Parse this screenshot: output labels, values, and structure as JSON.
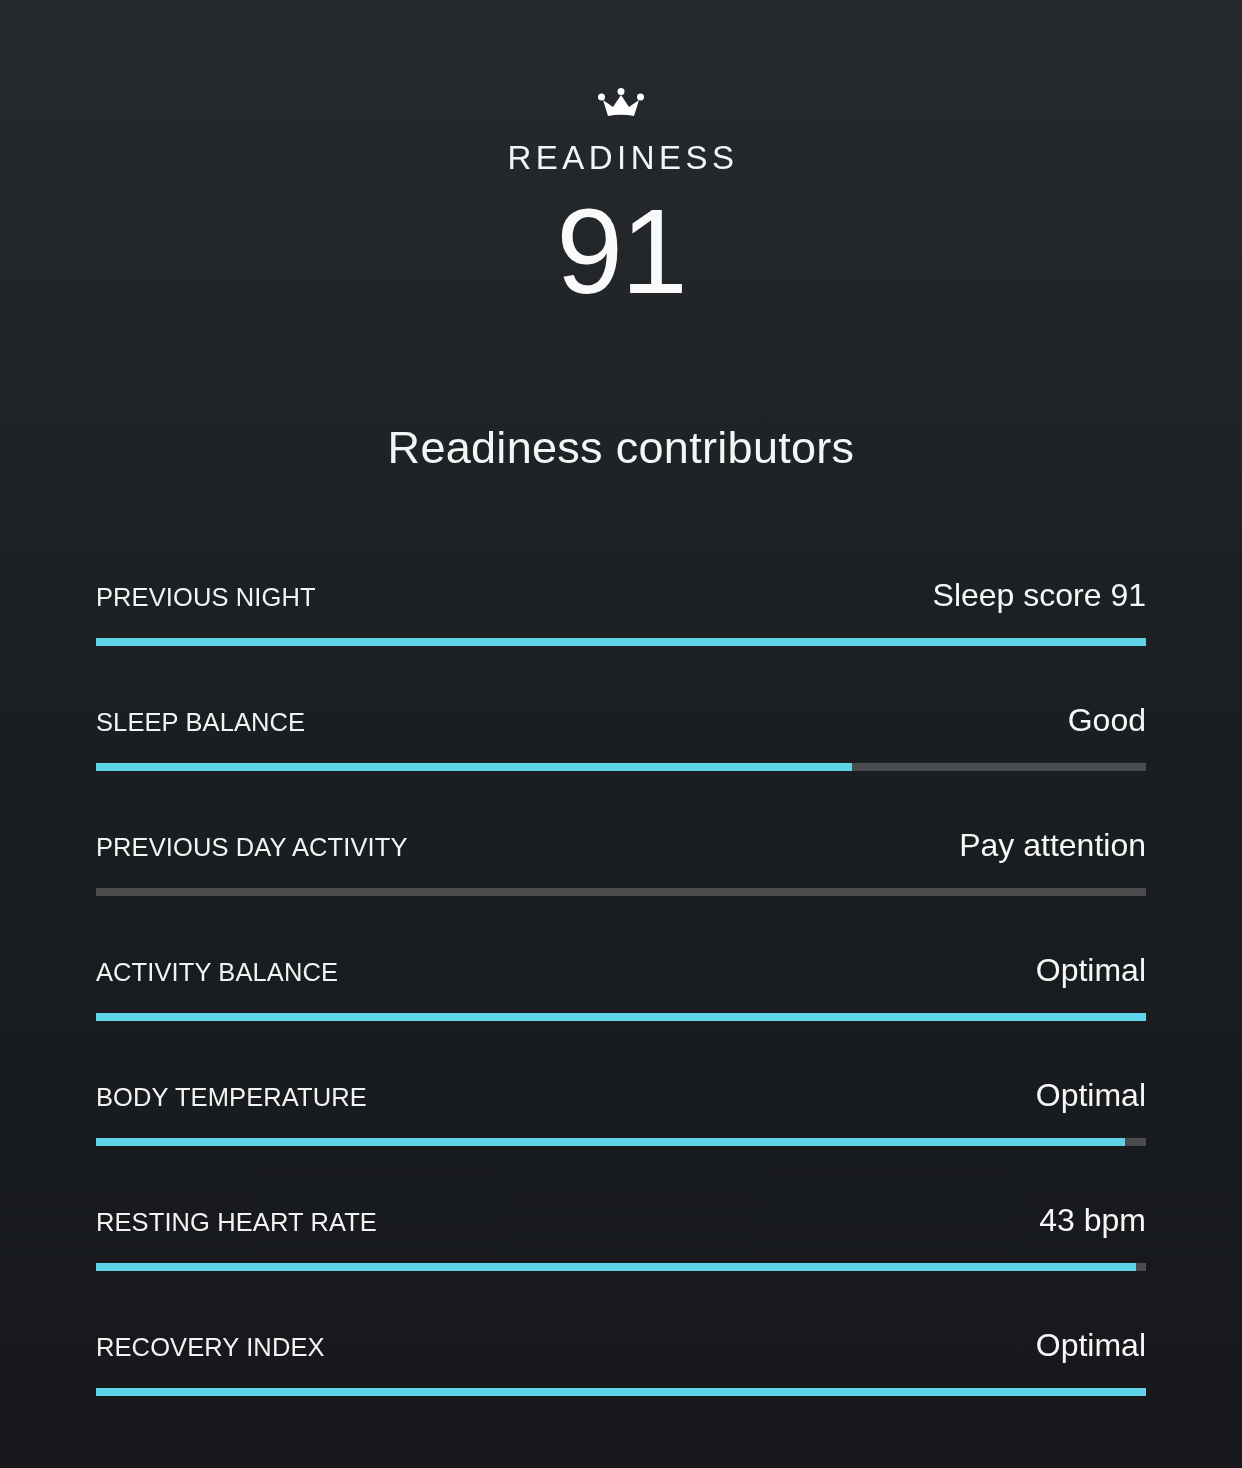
{
  "header": {
    "title": "READINESS",
    "score": "91"
  },
  "section_title": "Readiness contributors",
  "contributors": [
    {
      "label": "PREVIOUS NIGHT",
      "value": "Sleep score 91",
      "level": 1
    },
    {
      "label": "SLEEP BALANCE",
      "value": "Good",
      "level": 0.72
    },
    {
      "label": "PREVIOUS DAY ACTIVITY",
      "value": "Pay attention",
      "level": 0
    },
    {
      "label": "ACTIVITY BALANCE",
      "value": "Optimal",
      "level": 1
    },
    {
      "label": "BODY TEMPERATURE",
      "value": "Optimal",
      "level": 0.98
    },
    {
      "label": "RESTING HEART RATE",
      "value": "43 bpm",
      "level": 0.99
    },
    {
      "label": "RECOVERY INDEX",
      "value": "Optimal",
      "level": 1
    }
  ]
}
